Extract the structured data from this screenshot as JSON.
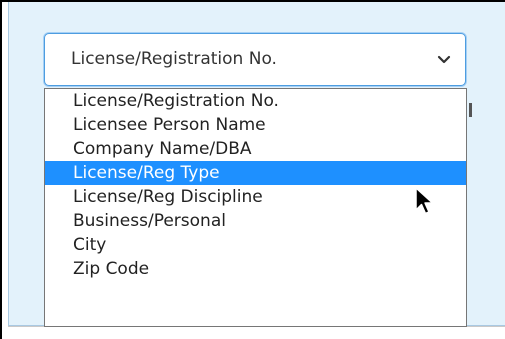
{
  "select": {
    "value": "License/Registration No."
  },
  "dropdown": {
    "options": [
      "License/Registration No.",
      "Licensee Person Name",
      "Company Name/DBA",
      "License/Reg Type",
      "License/Reg Discipline",
      "Business/Personal",
      "City",
      "Zip Code"
    ],
    "selected_index": 3
  },
  "colors": {
    "panel_background": "#e3f2fb",
    "highlight": "#1e90ff",
    "select_border": "#4d9de0"
  },
  "icons": {
    "arrow": "chevron-down-icon",
    "cursor": "mouse-pointer-icon"
  }
}
